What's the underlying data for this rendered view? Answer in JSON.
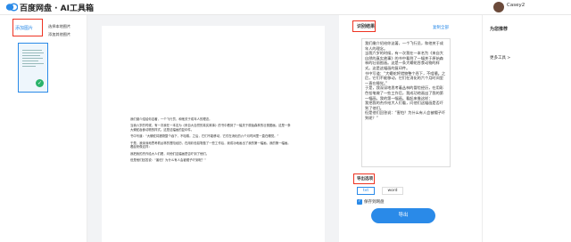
{
  "brand": {
    "title": "百度网盘 · AI工具箱"
  },
  "user": {
    "name": "Casey2"
  },
  "left": {
    "tab_label": "添加图片",
    "select_local": "选择本地图片",
    "add_other": "添加其他图片"
  },
  "doc": {
    "paragraphs": [
      "我们缴介绍给你这著，一个飞行员，和他关于成年人的理念。",
      "当我六岁的时候，有一次我在一本名为《来自大自然的真实故事》的书中看到了一幅关于原始森林的壮丽图画。这是一条大蟒蛇吞食动物的样式。这是这幅画的复印件。",
      "书中写道：“大蟒蛇将猎物整个吞下，不咀嚼。之后，它们不能移动，它们在消化的六个月时间里一直在睡觉。”",
      "于是，我深深地思考着丛林的冒险经历，在用彩色铅笔做了一些工作后，我成功地画出了我的第一幅画。我的第一幅画。看起来像这样：",
      "我把我的杰作给大人们看，问他们这幅画是否吓到了他们。",
      "但是他们回答说：“害怕？为什么有人会被帽子吓到呢？”"
    ]
  },
  "result": {
    "header": "识别结果",
    "copy_all": "复制全部",
    "paragraphs": [
      "我们缴介绍给你这著，一个飞行员，和他关于成年人的理念。",
      "当我六岁的时候，有一次我在一本名为《来自大自然的真实故事》的书中看到了一幅关于原始森林的壮丽图画。这是一条大蟒蛇吞食动物的样式。这是这幅画的复印件。",
      "书中写道：“大蟒蛇将猎物整个吞下，不咀嚼。之后，它们不能移动，它们在消化的六个月时间里一直在睡觉。”",
      "于是，我深深地思考着丛林的冒险经历，在用彩色铅笔做了一些工作后，我成功地画出了我的第一幅画。我的第一幅画。看起来像这样：",
      "我把我的杰作给大人们看，问他们这幅画是否吓到了他们。",
      "但是他们回答说：“害怕？为什么有人会被帽子吓到呢？”"
    ]
  },
  "export": {
    "header": "导出选项",
    "opt_txt": "txt",
    "opt_word": "word",
    "save_label": "保存到网盘",
    "button": "导出"
  },
  "recommend": {
    "header": "为您推荐",
    "more_tools": "更多工具 >"
  },
  "colors": {
    "accent": "#2a8ae8",
    "highlight": "#e32222",
    "success": "#2ab36b"
  }
}
